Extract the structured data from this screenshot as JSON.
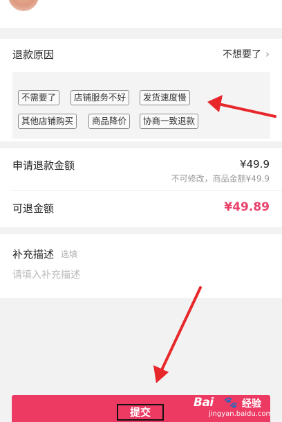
{
  "refund_reason": {
    "label": "退款原因",
    "value": "不想要了",
    "chevron": "chevron-right-icon",
    "tags": [
      "不需要了",
      "店铺服务不好",
      "发货速度慢",
      "其他店铺购买",
      "商品降价",
      "协商一致退款"
    ]
  },
  "amount": {
    "apply_label": "申请退款金额",
    "apply_value": "¥49.9",
    "apply_note": "不可修改，商品金额¥49.9",
    "refundable_label": "可退金额",
    "refundable_value": "¥49.89"
  },
  "description": {
    "title": "补充描述",
    "optional": "选填",
    "placeholder": "请填入补充描述"
  },
  "submit": {
    "label": "提交"
  },
  "watermark": {
    "logo": "Bai",
    "paw": "🐾",
    "brand": "经验",
    "url": "jingyan.baidu.com"
  },
  "colors": {
    "accent": "#ec3a63",
    "price": "#e9416a",
    "annotation_arrow": "#e8272b"
  },
  "icons": {
    "annotation_arrows": "red-arrow-icon"
  }
}
